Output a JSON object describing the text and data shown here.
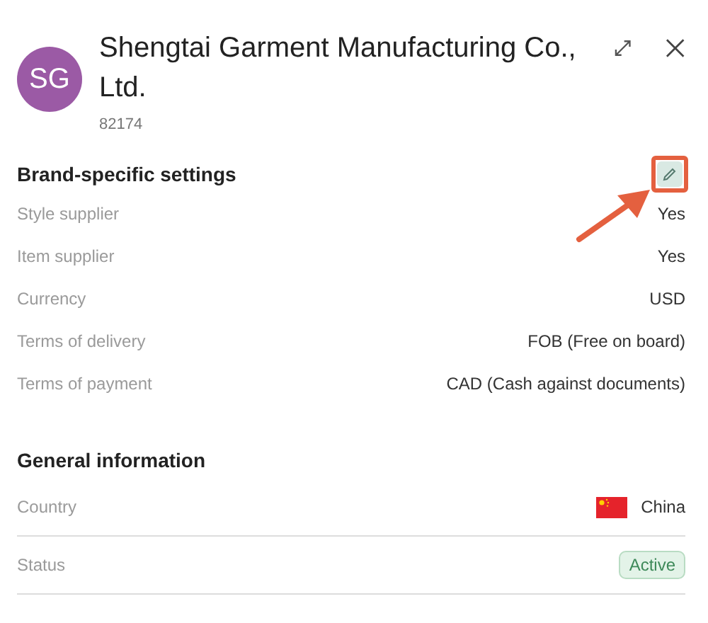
{
  "header": {
    "initials": "SG",
    "title": "Shengtai Garment Manufacturing Co., Ltd.",
    "id": "82174"
  },
  "sections": [
    {
      "title": "Brand-specific settings",
      "divided": false,
      "edit_button": {
        "highlighted": true
      },
      "rows": [
        {
          "label": "Style supplier",
          "kind": "text",
          "value": "Yes"
        },
        {
          "label": "Item supplier",
          "kind": "text",
          "value": "Yes"
        },
        {
          "label": "Currency",
          "kind": "text",
          "value": "USD"
        },
        {
          "label": "Terms of delivery",
          "kind": "text",
          "value": "FOB (Free on board)"
        },
        {
          "label": "Terms of payment",
          "kind": "text",
          "value": "CAD (Cash against documents)"
        }
      ]
    },
    {
      "title": "General information",
      "divided": true,
      "rows": [
        {
          "label": "Country",
          "kind": "flag",
          "value": "China"
        },
        {
          "label": "Status",
          "kind": "badge",
          "value": "Active"
        }
      ]
    }
  ]
}
